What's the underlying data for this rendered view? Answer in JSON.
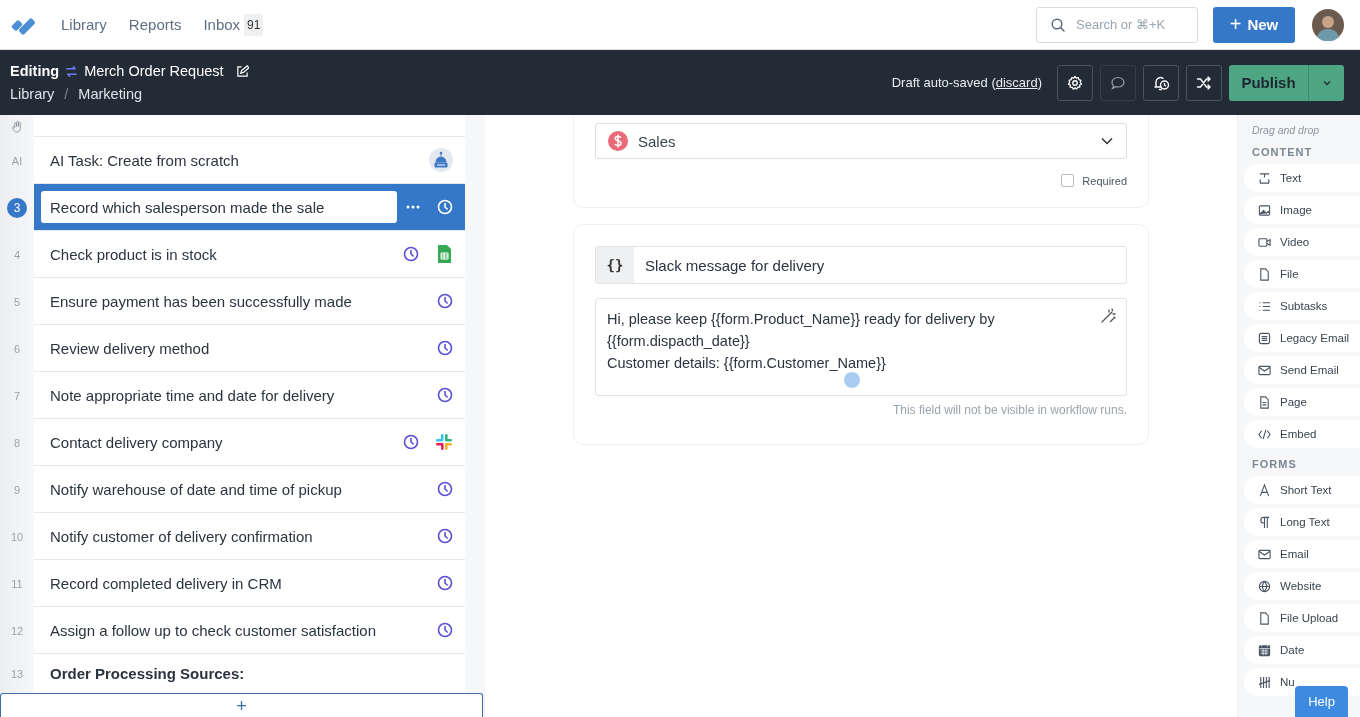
{
  "top_nav": {
    "links": [
      {
        "label": "Library"
      },
      {
        "label": "Reports"
      },
      {
        "label": "Inbox",
        "badge": "91"
      }
    ],
    "search": {
      "placeholder": "Search or ⌘+K"
    },
    "new_button": {
      "icon": "+",
      "label": "New"
    }
  },
  "editor_bar": {
    "mode": "Editing",
    "title": "Merch Order Request",
    "breadcrumb": [
      {
        "label": "Library"
      },
      {
        "label": "Marketing"
      }
    ],
    "breadcrumb_separator": "/",
    "save_status": {
      "before": "Draft auto-saved (",
      "link": "discard",
      "after": ")"
    },
    "tools": [
      {
        "kind": "settings",
        "disabled": false
      },
      {
        "kind": "comment",
        "disabled": true
      },
      {
        "kind": "reminder",
        "disabled": false
      },
      {
        "kind": "shuffle",
        "disabled": false
      }
    ],
    "publish_button": {
      "label": "Publish"
    }
  },
  "tasks": [
    {
      "kind": "task",
      "number": "AI",
      "title": "AI Task: Create from scratch",
      "selected": false,
      "markers": [
        {
          "kind": "robot"
        }
      ]
    },
    {
      "kind": "task",
      "number": "3",
      "title": "Record which salesperson made the sale",
      "selected": true,
      "markers": [
        {
          "kind": "more"
        },
        {
          "kind": "clock"
        }
      ]
    },
    {
      "kind": "task",
      "number": "4",
      "title": "Check product is in stock",
      "selected": false,
      "markers": [
        {
          "kind": "clock"
        },
        {
          "kind": "sheet"
        }
      ]
    },
    {
      "kind": "task",
      "number": "5",
      "title": "Ensure payment has been successfully made",
      "selected": false,
      "markers": [
        {
          "kind": "clock"
        }
      ]
    },
    {
      "kind": "task",
      "number": "6",
      "title": "Review delivery method",
      "selected": false,
      "markers": [
        {
          "kind": "clock"
        }
      ]
    },
    {
      "kind": "task",
      "number": "7",
      "title": "Note appropriate time and date for delivery",
      "selected": false,
      "markers": [
        {
          "kind": "clock"
        }
      ]
    },
    {
      "kind": "task",
      "number": "8",
      "title": "Contact delivery company",
      "selected": false,
      "markers": [
        {
          "kind": "clock"
        },
        {
          "kind": "slack"
        }
      ]
    },
    {
      "kind": "task",
      "number": "9",
      "title": "Notify warehouse of date and time of pickup",
      "selected": false,
      "markers": [
        {
          "kind": "clock"
        }
      ]
    },
    {
      "kind": "task",
      "number": "10",
      "title": "Notify customer of delivery confirmation",
      "selected": false,
      "markers": [
        {
          "kind": "clock"
        }
      ]
    },
    {
      "kind": "task",
      "number": "11",
      "title": "Record completed delivery in CRM",
      "selected": false,
      "markers": [
        {
          "kind": "clock"
        }
      ]
    },
    {
      "kind": "task",
      "number": "12",
      "title": "Assign a follow up to check customer satisfaction",
      "selected": false,
      "markers": [
        {
          "kind": "clock"
        }
      ]
    },
    {
      "kind": "heading",
      "number": "13",
      "title": "Order Processing Sources:",
      "selected": false
    }
  ],
  "add_task_button": {
    "label": "+"
  },
  "form": {
    "select": {
      "value": "Sales"
    },
    "required": {
      "label": "Required",
      "checked": false
    },
    "field": {
      "icon": "{}",
      "label": "Slack message for delivery"
    },
    "message_lines": [
      "Hi, please keep {{form.Product_Name}} ready for delivery by",
      "{{form.dispacth_date}}",
      "Customer details: {{form.Customer_Name}}"
    ],
    "hint": "This field will not be visible in workflow runs."
  },
  "sidebar": {
    "hint": "Drag and drop",
    "sections": [
      {
        "title": "CONTENT",
        "items": [
          {
            "label": "Text",
            "kind": "text"
          },
          {
            "label": "Image",
            "kind": "image"
          },
          {
            "label": "Video",
            "kind": "video"
          },
          {
            "label": "File",
            "kind": "file"
          },
          {
            "label": "Subtasks",
            "kind": "list"
          },
          {
            "label": "Legacy Email",
            "kind": "legacy"
          },
          {
            "label": "Send Email",
            "kind": "mail"
          },
          {
            "label": "Page",
            "kind": "page"
          },
          {
            "label": "Embed",
            "kind": "code"
          }
        ]
      },
      {
        "title": "FORMS",
        "items": [
          {
            "label": "Short Text",
            "kind": "letter"
          },
          {
            "label": "Long Text",
            "kind": "pilcrow"
          },
          {
            "label": "Email",
            "kind": "mail"
          },
          {
            "label": "Website",
            "kind": "globe"
          },
          {
            "label": "File Upload",
            "kind": "file"
          },
          {
            "label": "Date",
            "kind": "calendar"
          },
          {
            "label": "Nu",
            "kind": "hash"
          }
        ]
      }
    ]
  },
  "help_button": {
    "label": "Help"
  }
}
